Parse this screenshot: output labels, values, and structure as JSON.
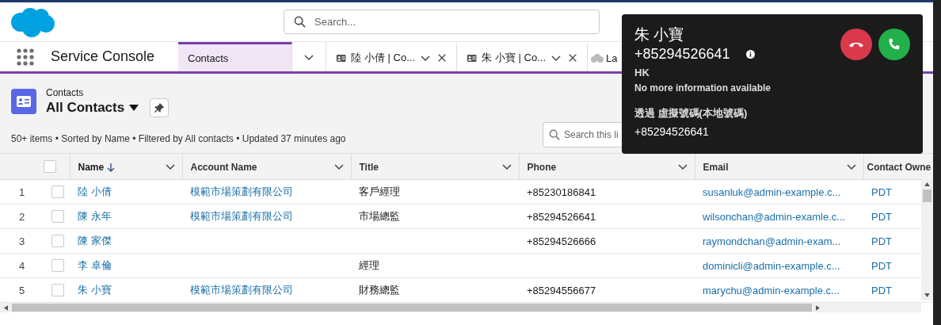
{
  "header": {
    "search": {
      "placeholder": "Search..."
    }
  },
  "nav": {
    "app_name": "Service Console",
    "tabs": [
      {
        "kind": "object",
        "label": "Contacts",
        "selected": true
      },
      {
        "kind": "record",
        "label": "陸 小倩 | Co...",
        "selected": false
      },
      {
        "kind": "record",
        "label": "朱 小寶 | Co...",
        "selected": false
      },
      {
        "kind": "cloud",
        "label": "La",
        "selected": false
      }
    ]
  },
  "list_view": {
    "object": "Contacts",
    "title": "All Contacts",
    "meta": "50+ items • Sorted by Name • Filtered by All contacts • Updated 37 minutes ago",
    "search": {
      "placeholder": "Search this li"
    }
  },
  "table": {
    "select_all_checked": false,
    "columns": [
      {
        "label": "Name",
        "sorted": true
      },
      {
        "label": "Account Name",
        "sorted": false
      },
      {
        "label": "Title",
        "sorted": false
      },
      {
        "label": "Phone",
        "sorted": false
      },
      {
        "label": "Email",
        "sorted": false
      },
      {
        "label": "Contact Owne",
        "sorted": false
      }
    ],
    "rows": [
      {
        "number": "1",
        "checked": false,
        "cells": [
          "陸 小倩",
          "模範市場策劃有限公司",
          "客戶經理",
          "+85230186841",
          "susanluk@admin-example.c...",
          "PDT"
        ]
      },
      {
        "number": "2",
        "checked": false,
        "cells": [
          "陳 永年",
          "模範市場策劃有限公司",
          "市場總監",
          "+85294526641",
          "wilsonchan@admin-examle.c...",
          "PDT"
        ]
      },
      {
        "number": "3",
        "checked": false,
        "cells": [
          "陳 家傑",
          "",
          "",
          "+85294526666",
          "raymondchan@admin-exam...",
          "PDT"
        ]
      },
      {
        "number": "4",
        "checked": false,
        "cells": [
          "李 卓倫",
          "",
          "經理",
          "",
          "dominicli@admin-example.c...",
          "PDT"
        ]
      },
      {
        "number": "5",
        "checked": false,
        "cells": [
          "朱 小寶",
          "模範市場策劃有限公司",
          "財務總監",
          "+85294556677",
          "marychu@admin-example.c...",
          "PDT"
        ]
      }
    ]
  },
  "call_popup": {
    "caller_name": "朱 小寶",
    "caller_number": "+85294526641",
    "region": "HK",
    "info": "No more information available",
    "via_label": "透過 虛擬號碼(本地號碼)",
    "via_number": "+85294526641"
  }
}
